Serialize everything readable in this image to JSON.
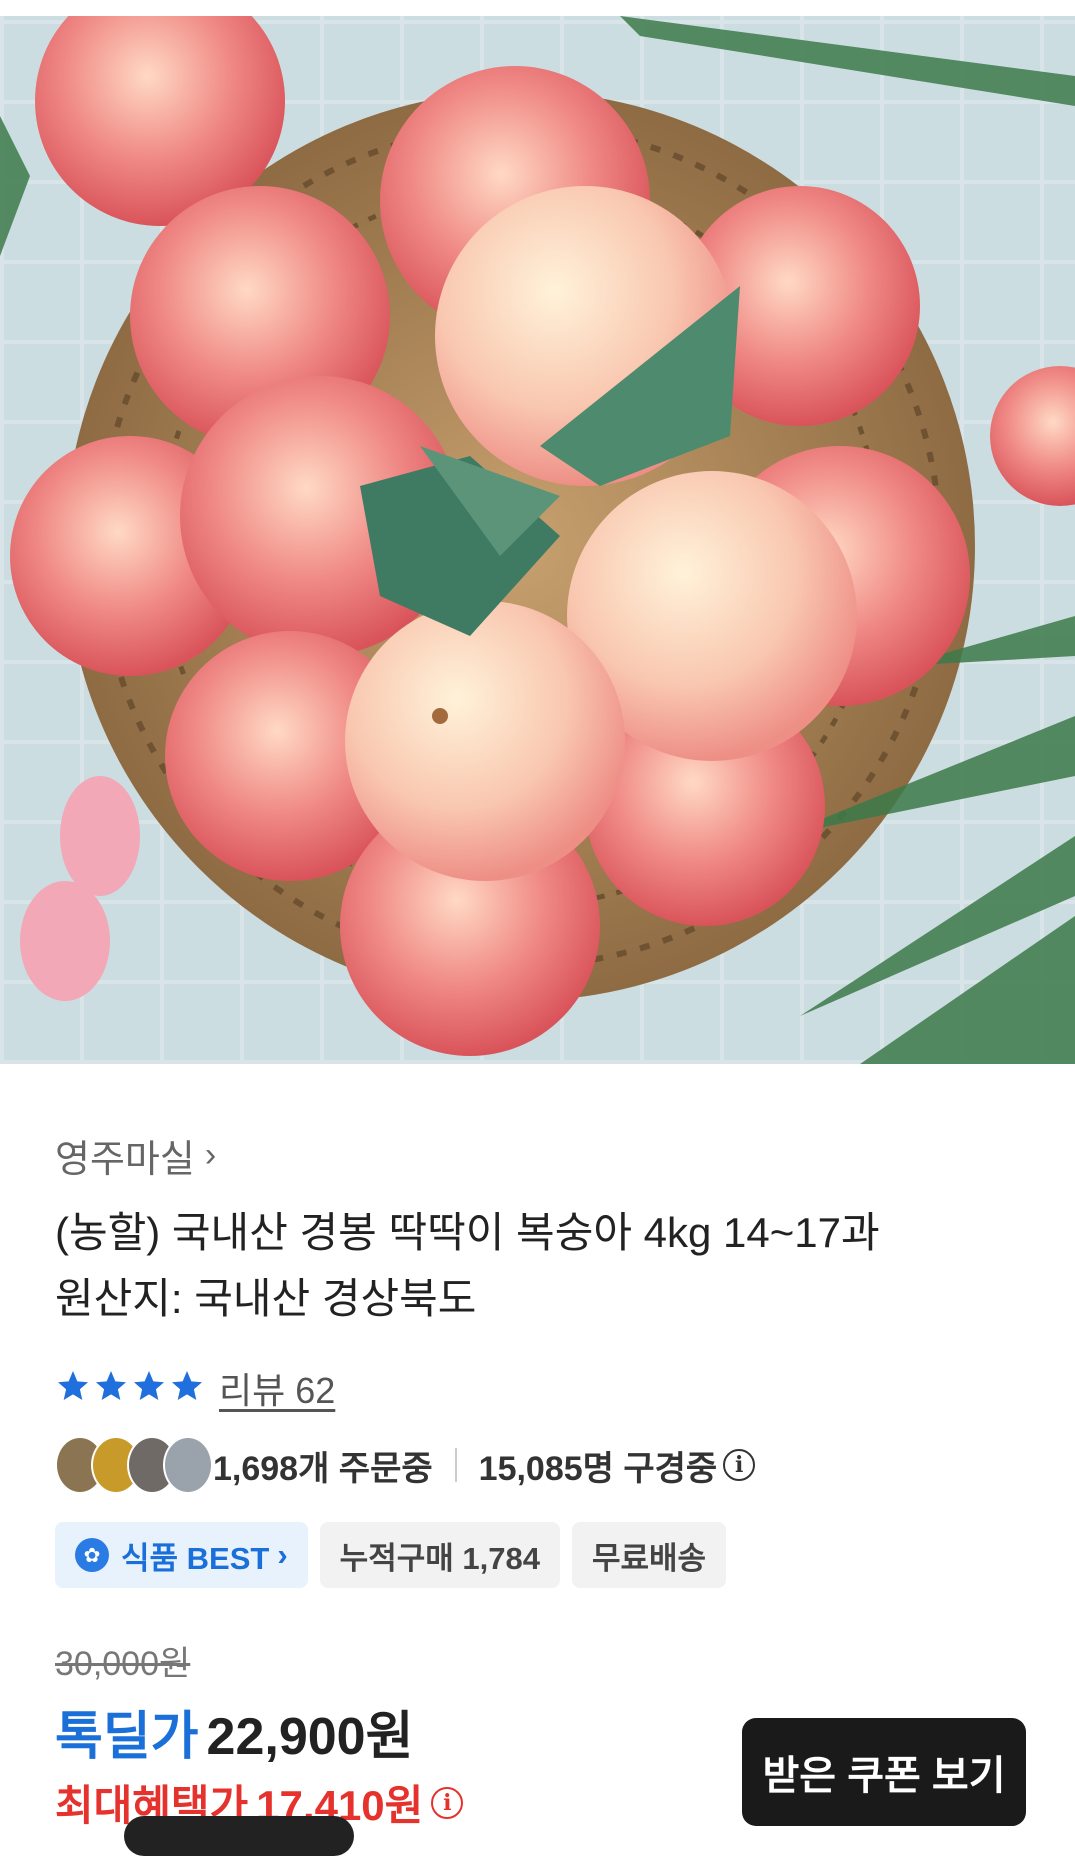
{
  "product": {
    "seller": "영주마실",
    "title_line1": "(농할) 국내산 경봉 딱딱이 복숭아 4kg 14~17과",
    "title_line2": "원산지: 국내산 경상북도",
    "rating_stars": 4,
    "review_label": "리뷰 62",
    "orders": "1,698개 주문중",
    "viewers": "15,085명 구경중",
    "chips": {
      "best": "식품 BEST",
      "cumulative": "누적구매 1,784",
      "shipping": "무료배송"
    },
    "original_price": "30,000원",
    "deal_label": "톡딜가",
    "deal_price": "22,900원",
    "max_label": "최대혜택가",
    "max_price": "17,410원",
    "coupon_button": "받은 쿠폰 보기"
  },
  "colors": {
    "accent_blue": "#1a6fd8",
    "star": "#1f6fdc",
    "benefit_red": "#e5322d"
  },
  "icons": {
    "info": "info-circle-icon",
    "chevron": "chevron-right-icon",
    "star": "star-icon"
  }
}
